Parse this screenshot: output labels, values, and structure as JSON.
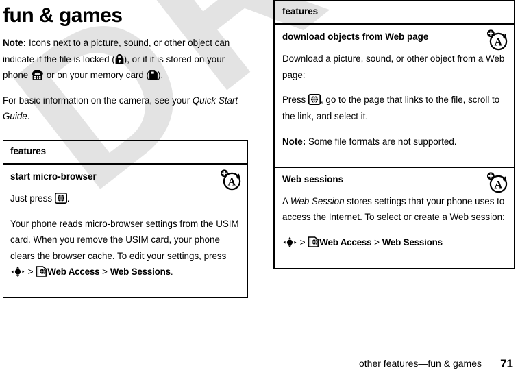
{
  "document": {
    "title": "fun & games",
    "watermark": "DRAFT"
  },
  "intro": {
    "note_label": "Note:",
    "note_text_1": " Icons next to a picture, sound, or other object can indicate if the file is locked (",
    "note_text_2": "), or if it is stored on your phone ",
    "note_text_3": " or on your memory card (",
    "note_text_4": ").",
    "lock_icon": "lock-icon",
    "phone_icon": "phone-icon",
    "memory_card_icon": "memory-card-icon",
    "camera_text_1": "For basic information on the camera, see your ",
    "camera_guide_title": "Quick Start Guide",
    "camera_text_2": "."
  },
  "left_table": {
    "header": "features",
    "rows": [
      {
        "title": "start micro-browser",
        "badge_icon": "browser-feature-badge-icon",
        "para1_pre": "Just press ",
        "para1_icon": "browser-key-icon",
        "para1_post": ".",
        "para2_pre": "Your phone reads micro-browser settings from the USIM card. When you remove the USIM card, your phone clears the browser cache. To edit your settings, press ",
        "nav_joystick_icon": "joystick-icon",
        "nav_sep1": " > ",
        "nav_webaccess_icon": "web-access-icon",
        "nav_item1": "Web Access",
        "nav_sep2": " > ",
        "nav_item2": "Web Sessions",
        "para2_post": "."
      }
    ]
  },
  "right_table": {
    "header": "features",
    "rows": [
      {
        "title": "download objects from Web page",
        "badge_icon": "browser-feature-badge-icon",
        "para1": "Download a picture, sound, or other object from a Web page:",
        "para2_pre": "Press ",
        "para2_icon": "browser-key-icon",
        "para2_post": ", go to the page that links to the file, scroll to the link, and select it.",
        "note_label": "Note:",
        "note_text": " Some file formats are not supported."
      },
      {
        "title": "Web sessions",
        "badge_icon": "browser-feature-badge-icon",
        "para1_pre": "A ",
        "para1_ital": "Web Session",
        "para1_post": " stores settings that your phone uses to access the Internet. To select or create a Web session:",
        "nav_joystick_icon": "joystick-icon",
        "nav_sep1": " > ",
        "nav_webaccess_icon": "web-access-icon",
        "nav_item1": "Web Access",
        "nav_sep2": " > ",
        "nav_item2": "Web Sessions"
      }
    ]
  },
  "footer": {
    "text": "other features—fun & games",
    "page_number": "71"
  },
  "colors": {
    "ink": "#000000",
    "paper": "#ffffff",
    "watermark": "#e3e3e3"
  }
}
